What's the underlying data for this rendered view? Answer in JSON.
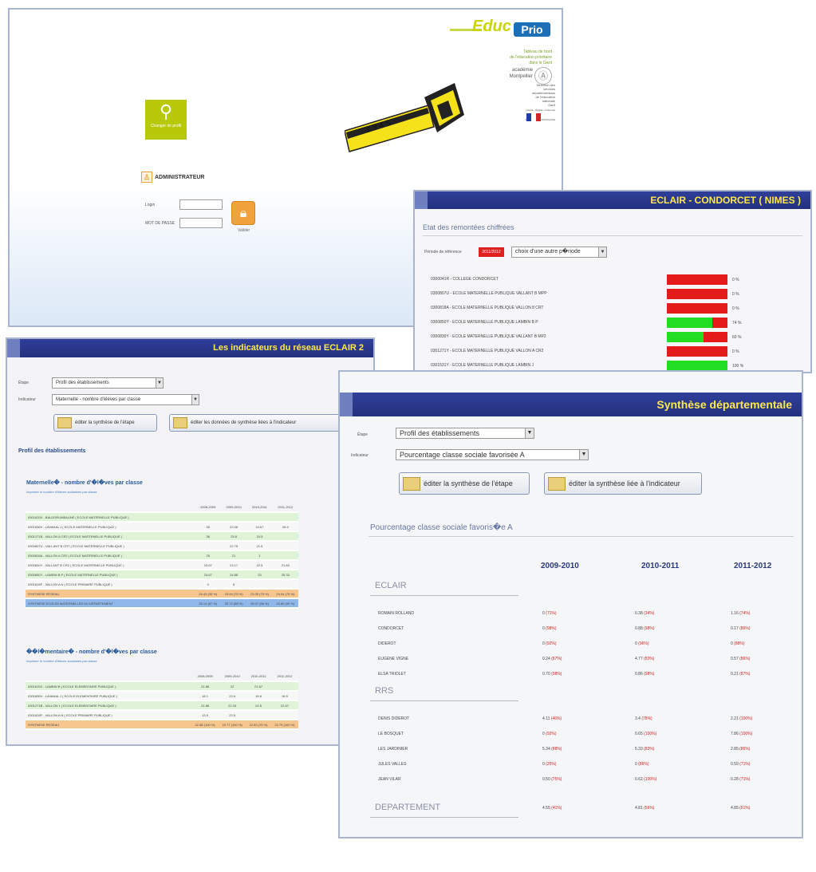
{
  "login": {
    "logo_edu": "Educ",
    "logo_prio": "Prio",
    "tagline": [
      "Tableau de bord",
      "de l'éducation prioritaire",
      "dans le Gard"
    ],
    "ministry": [
      "académie",
      "Montpellier",
      "Direction des",
      "services",
      "départementaux",
      "de l'éducation",
      "nationale",
      "Gard",
      "Liberté • Égalité • Fraternité",
      "RÉPUBLIQUE FRANÇAISE"
    ],
    "tile_label": "Changer de profil",
    "admin_label": "ADMINISTRATEUR",
    "login_label": "Login",
    "password_label": "MOT DE PASSE",
    "submit_label": "Valider"
  },
  "eclair": {
    "title": "ECLAIR - CONDORCET ( NIMES )",
    "section": "Etat des remontées chiffrées",
    "period_label": "Période de référence",
    "period_value": "2011/2012",
    "select_value": "choix d'une autre p�riode",
    "rows": [
      {
        "label": "0300041R - COLLEGE CONDORCET",
        "fill": 0,
        "pct": "0 %"
      },
      {
        "label": "0300807U - ECOLE MATERNELLE PUBLIQUE VALLANT B MPP",
        "fill": 0,
        "pct": "0 %"
      },
      {
        "label": "0300818A - ECOLE MATERNELLE PUBLIQUE VALLON 8 CRT",
        "fill": 0,
        "pct": "0 %"
      },
      {
        "label": "0300850Y - ECOLE MATERNELLE PUBLIQUE LAMBIN B P",
        "fill": 0.75,
        "pct": "74 %"
      },
      {
        "label": "0300830Y - ECOLE MATERNELLE PUBLIQUE VALLANT B MP2",
        "fill": 0.6,
        "pct": "60 %"
      },
      {
        "label": "0301271Y - ECOLE MATERNELLE PUBLIQUE VALLON A CR2",
        "fill": 0,
        "pct": "0 %"
      },
      {
        "label": "0301531Y - ECOLE MATERNELLE PUBLIQUE LAMBIN J",
        "fill": 1,
        "pct": "100 %"
      }
    ]
  },
  "indic": {
    "title": "Les indicateurs du réseau ECLAIR 2",
    "etape_label": "Étape",
    "etape_value": "Profil des établissements",
    "indic_label": "Indicateur",
    "indic_value": "Maternelle - nombre d'élèves par classe",
    "btn1": "éditer la synthèse de l'étape",
    "btn2": "éditer les données de synthèse liées à l'indicateur",
    "heading": "Profil des établissements",
    "table1": {
      "title": "Maternelle� - nombre d'�l�ves par classe",
      "link": "Imprimer le nombre d'élèves scolarisés par classe",
      "cols": [
        "2008-2009",
        "2009-2010",
        "2010-2011",
        "2011-2012"
      ],
      "rows": [
        {
          "s": "g",
          "c": [
            "0301815X - BALDORUMBAUNE ( ECOLE MATERNELLE PUBLIQUE )",
            "",
            "",
            "",
            ""
          ]
        },
        {
          "s": "w",
          "c": [
            "0301836V - LAVANAL J ( ECOLE MATERNELLE PUBLIQUE )",
            "35",
            "22.06",
            "24.67",
            "26.5"
          ]
        },
        {
          "s": "g",
          "c": [
            "0301271B - VALLON A CR2 ( ECOLE MATERNELLE PUBLIQUE )",
            "36",
            "25.8",
            "24.5",
            ""
          ]
        },
        {
          "s": "w",
          "c": [
            "0300807U - VALLANT B CRT ( ECOLE MATERNELLE PUBLIQUE )",
            "",
            "22.75",
            "21.6",
            ""
          ]
        },
        {
          "s": "g",
          "c": [
            "0300818A - VALLON A CR2 ( ECOLE MATERNELLE PUBLIQUE )",
            "25",
            "21",
            "1",
            ""
          ]
        },
        {
          "s": "w",
          "c": [
            "0300830Y - VALLANT B CR2 ( ECOLE MATERNELLE PUBLIQUE )",
            "23.67",
            "23.17",
            "22.5",
            "21.83"
          ]
        },
        {
          "s": "g",
          "c": [
            "0300850Y - LAMBIN B P ( ECOLE MATERNELLE PUBLIQUE )",
            "24.67",
            "24.88",
            "25",
            "25.33"
          ]
        },
        {
          "s": "w",
          "c": [
            "0301818F - VALLON A N ( ECOLE PRIMAIRE PUBLIQUE )",
            "0",
            "8",
            "",
            ""
          ]
        },
        {
          "s": "o",
          "c": [
            "SYNTHESE RESEAU",
            "24.43 (35 %)",
            "23.54 (75 %)",
            "23.05 (75 %)",
            "24.04 (75 %)"
          ]
        },
        {
          "s": "b",
          "c": [
            "SYNTHESE ECOLES MATERNELLES DU DEPARTEMENT",
            "25.14 (87 %)",
            "25.72 (88 %)",
            "25.07 (86 %)",
            "25.80 (90 %)"
          ]
        }
      ]
    },
    "table2": {
      "title": "��l�mentaire� - nombre d'�l�ves par classe",
      "link": "Imprimer le nombre d'élèves scolarisés par classe",
      "cols": [
        "2008-2009",
        "2009-2010",
        "2010-2011",
        "2011-2012"
      ],
      "rows": [
        {
          "s": "g",
          "c": [
            "0301815X - LAMBIN B ( ECOLE ELEMENTAIRE PUBLIQUE )",
            "21.88",
            "22",
            "21.67",
            ""
          ]
        },
        {
          "s": "w",
          "c": [
            "0301836V - LAVANAL J ( ECOLE ELEMENTAIRE PUBLIQUE )",
            "18.1",
            "22.6",
            "18.8",
            "18.5"
          ]
        },
        {
          "s": "g",
          "c": [
            "0301271B - VALLON 1 ( ECOLE ELEMENTAIRE PUBLIQUE )",
            "21.88",
            "22.33",
            "24.5",
            "22.67"
          ]
        },
        {
          "s": "w",
          "c": [
            "0301818F - VALLON A N ( ECOLE PRIMAIRE PUBLIQUE )",
            "13.5",
            "22.5",
            "",
            ""
          ]
        },
        {
          "s": "o",
          "c": [
            "SYNTHESE RESEAU",
            "22.58 (100 %)",
            "22.77 (100 %)",
            "22.53 (75 %)",
            "22.79 (100 %)"
          ]
        }
      ]
    }
  },
  "synth": {
    "title": "Synthèse départementale",
    "etape_label": "Étape",
    "etape_value": "Profil des établissements",
    "indic_label": "Indicateur",
    "indic_value": "Pourcentage classe sociale favorisée A",
    "btn1": "éditer la synthèse de l'étape",
    "btn2": "éditer la synthèse liée à l'indicateur",
    "heading": "Pourcentage classe sociale favoris�e A",
    "years": [
      "2009-2010",
      "2010-2011",
      "2011-2012"
    ],
    "groups": [
      {
        "name": "ECLAIR",
        "rows": [
          {
            "n": "ROMAIN ROLLAND",
            "a": [
              "0 ",
              "(71%)"
            ],
            "b": [
              "0.38 ",
              "(34%)"
            ],
            "c": [
              "1.16 ",
              "(74%)"
            ]
          },
          {
            "n": "CONDORCET",
            "a": [
              "0 ",
              "(98%)"
            ],
            "b": [
              "0.88 ",
              "(98%)"
            ],
            "c": [
              "0.17 ",
              "(86%)"
            ]
          },
          {
            "n": "DIDEROT",
            "a": [
              "0 ",
              "(92%)"
            ],
            "b": [
              "0 ",
              "(96%)"
            ],
            "c": [
              "0 ",
              "(88%)"
            ]
          },
          {
            "n": "EUGENE VIGNE",
            "a": [
              "0.24 ",
              "(87%)"
            ],
            "b": [
              "4.77 ",
              "(83%)"
            ],
            "c": [
              "0.57 ",
              "(86%)"
            ]
          },
          {
            "n": "ELSA TRIOLET",
            "a": [
              "0.70 ",
              "(98%)"
            ],
            "b": [
              "0.86 ",
              "(98%)"
            ],
            "c": [
              "0.21 ",
              "(87%)"
            ]
          }
        ]
      },
      {
        "name": "RRS",
        "rows": [
          {
            "n": "DENIS DIDEROT",
            "a": [
              "4.11 ",
              "(46%)"
            ],
            "b": [
              "3.4 ",
              "(78%)"
            ],
            "c": [
              "2.21 ",
              "(100%)"
            ]
          },
          {
            "n": "LE BOSQUET",
            "a": [
              "0 ",
              "(92%)"
            ],
            "b": [
              "0.65 ",
              "(100%)"
            ],
            "c": [
              "7.86 ",
              "(100%)"
            ]
          },
          {
            "n": "LES JARDINIER",
            "a": [
              "5.34 ",
              "(88%)"
            ],
            "b": [
              "5.33 ",
              "(83%)"
            ],
            "c": [
              "2.85 ",
              "(86%)"
            ]
          },
          {
            "n": "JULES VALLES",
            "a": [
              "0 ",
              "(25%)"
            ],
            "b": [
              "0 ",
              "(86%)"
            ],
            "c": [
              "0.59 ",
              "(71%)"
            ]
          },
          {
            "n": "JEAN VILAR",
            "a": [
              "0.50 ",
              "(75%)"
            ],
            "b": [
              "0.62 ",
              "(100%)"
            ],
            "c": [
              "0.28 ",
              "(71%)"
            ]
          }
        ]
      },
      {
        "name": "DEPARTEMENT",
        "rows": [
          {
            "n": "",
            "a": [
              "4.55 ",
              "(41%)"
            ],
            "b": [
              "4.81 ",
              "(56%)"
            ],
            "c": [
              "4.85 ",
              "(61%)"
            ]
          }
        ]
      }
    ]
  },
  "colors": {
    "title_bg": "#2f3f9a",
    "title_text": "#ffe84a",
    "bar_red": "#e41b1b",
    "bar_green": "#22dd22",
    "accent_green": "#b8c90a"
  }
}
